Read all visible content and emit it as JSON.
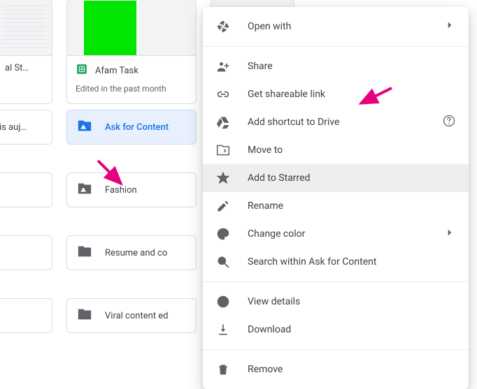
{
  "files": {
    "left_partial_title": "al St…",
    "afam_title": "Afam Task",
    "afam_sub": "Edited in the past month"
  },
  "folders": {
    "left_partial_0": "is auj…",
    "left_partial_1": "",
    "left_partial_2": "",
    "left_partial_3": "",
    "selected": "Ask for Content",
    "fashion": "Fashion",
    "resume": "Resume and co",
    "viral": "Viral content ed"
  },
  "menu": {
    "open_with": "Open with",
    "share": "Share",
    "get_link": "Get shareable link",
    "shortcut": "Add shortcut to Drive",
    "move_to": "Move to",
    "star": "Add to Starred",
    "rename": "Rename",
    "color": "Change color",
    "search_within": "Search within Ask for Content",
    "view_details": "View details",
    "download": "Download",
    "remove": "Remove"
  }
}
